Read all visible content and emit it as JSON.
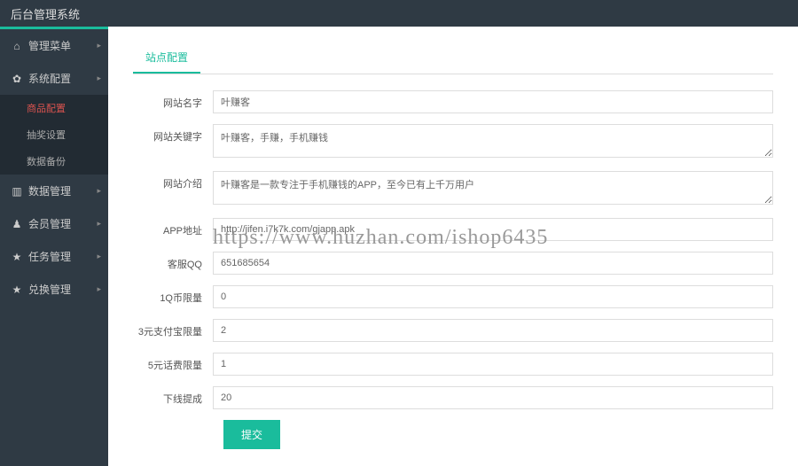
{
  "topbar": {
    "title": "后台管理系统"
  },
  "sidebar": {
    "items": [
      {
        "icon": "home-icon",
        "label": "管理菜单",
        "arrow": "▸"
      },
      {
        "icon": "cogs-icon",
        "label": "系统配置",
        "arrow": "▸",
        "submenu": [
          {
            "label": "商品配置",
            "active": true
          },
          {
            "label": "抽奖设置"
          },
          {
            "label": "数据备份"
          }
        ]
      },
      {
        "icon": "bar-chart-icon",
        "label": "数据管理",
        "arrow": "▸"
      },
      {
        "icon": "user-icon",
        "label": "会员管理",
        "arrow": "▸"
      },
      {
        "icon": "star-icon",
        "label": "任务管理",
        "arrow": "▸"
      },
      {
        "icon": "star-icon",
        "label": "兑换管理",
        "arrow": "▸"
      }
    ]
  },
  "tab": {
    "label": "站点配置"
  },
  "form": {
    "site_name": {
      "label": "网站名字",
      "value": "叶赚客"
    },
    "keywords": {
      "label": "网站关键字",
      "value": "叶赚客，手赚，手机赚钱"
    },
    "intro": {
      "label": "网站介绍",
      "value": "叶赚客是一款专注于手机赚钱的APP，至今已有上千万用户"
    },
    "app_url": {
      "label": "APP地址",
      "value": "http://jifen.i7k7k.com/gjapp.apk"
    },
    "qq": {
      "label": "客服QQ",
      "value": "651685654"
    },
    "q_limit": {
      "label": "1Q币限量",
      "value": "0"
    },
    "alipay_limit": {
      "label": "3元支付宝限量",
      "value": "2"
    },
    "phone_limit": {
      "label": "5元话费限量",
      "value": "1"
    },
    "downline": {
      "label": "下线提成",
      "value": "20"
    },
    "submit": "提交"
  },
  "watermark": "https://www.huzhan.com/ishop6435"
}
